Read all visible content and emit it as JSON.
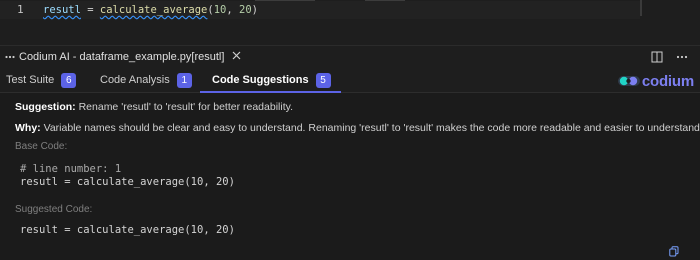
{
  "editor": {
    "line_number": "1",
    "code": {
      "var": "resutl",
      "op": " = ",
      "fn": "calculate_average",
      "open": "(",
      "arg1": "10",
      "sep": ", ",
      "arg2": "20",
      "close": ")"
    }
  },
  "panel": {
    "title": "Codium AI - dataframe_example.py[resutl]",
    "close_icon": "close-icon",
    "split_icon": "split-editor-icon",
    "more_icon": "more-icon"
  },
  "tabs": [
    {
      "label": "Test Suite",
      "badge": "6"
    },
    {
      "label": "Code Analysis",
      "badge": "1"
    },
    {
      "label": "Code Suggestions",
      "badge": "5"
    }
  ],
  "brand": {
    "text": "codium",
    "color": "#7c7ff0"
  },
  "suggestion": {
    "suggestion_label": "Suggestion:",
    "suggestion_text": " Rename 'resutl' to 'result' for better readability.",
    "why_label": "Why:",
    "why_text": " Variable names should be clear and easy to understand. Renaming 'resutl' to 'result' makes the code more readable and easier to understand.",
    "base_label": "Base Code:",
    "base_comment": "# line number: 1",
    "base_code": "resutl = calculate_average(10, 20)",
    "suggested_label": "Suggested Code:",
    "suggested_code": "result = calculate_average(10, 20)"
  },
  "colors": {
    "accent": "#5c63e6",
    "background": "#1e1e1e"
  }
}
